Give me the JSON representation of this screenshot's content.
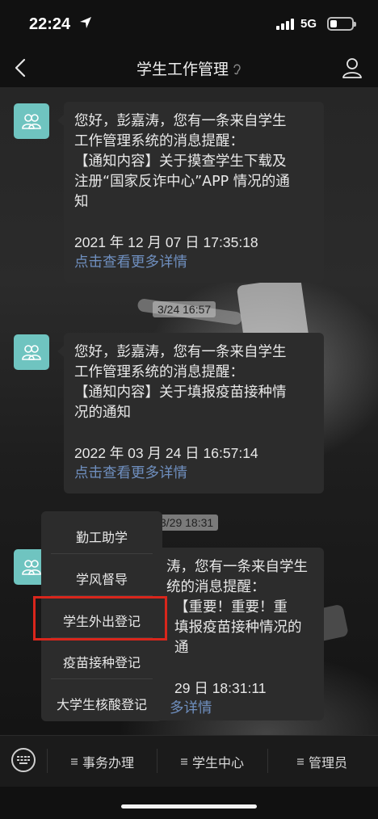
{
  "status_bar": {
    "time": "22:24",
    "network": "5G"
  },
  "header": {
    "title": "学生工作管理",
    "back_icon": "chevron-left-icon",
    "profile_icon": "person-icon"
  },
  "timestamps": [
    "3/24 16:57",
    "3/29 18:31"
  ],
  "messages": [
    {
      "line1": "您好，彭嘉涛，您有一条来自学生",
      "line2": "工作管理系统的消息提醒：",
      "line3": "【通知内容】关于摸查学生下载及",
      "line4": "注册“国家反诈中心”APP 情况的通",
      "line5": "知",
      "datetime": "2021 年 12 月 07 日  17:35:18",
      "link": "点击查看更多详情"
    },
    {
      "line1": "您好，彭嘉涛，您有一条来自学生",
      "line2": "工作管理系统的消息提醒：",
      "line3": "【通知内容】关于填报疫苗接种情",
      "line4": "况的通知",
      "datetime": "2022 年 03 月 24 日  16:57:14",
      "link": "点击查看更多详情"
    },
    {
      "line1": "涛，您有一条来自学生",
      "line2": "统的消息提醒：",
      "line3": "【重要！重要！重",
      "line4": "填报疫苗接种情况的通",
      "datetime": "29 日  18:31:11",
      "link": "多详情"
    }
  ],
  "popup_menu": [
    "勤工助学",
    "学风督导",
    "学生外出登记",
    "疫苗接种登记",
    "大学生核酸登记"
  ],
  "bottom_menu": {
    "keyboard_icon": "keyboard-icon",
    "items": [
      "事务办理",
      "学生中心",
      "管理员"
    ]
  },
  "colors": {
    "avatar_bg": "#6fc4c0",
    "link": "#6f8fbf",
    "highlight": "#d9261c"
  }
}
